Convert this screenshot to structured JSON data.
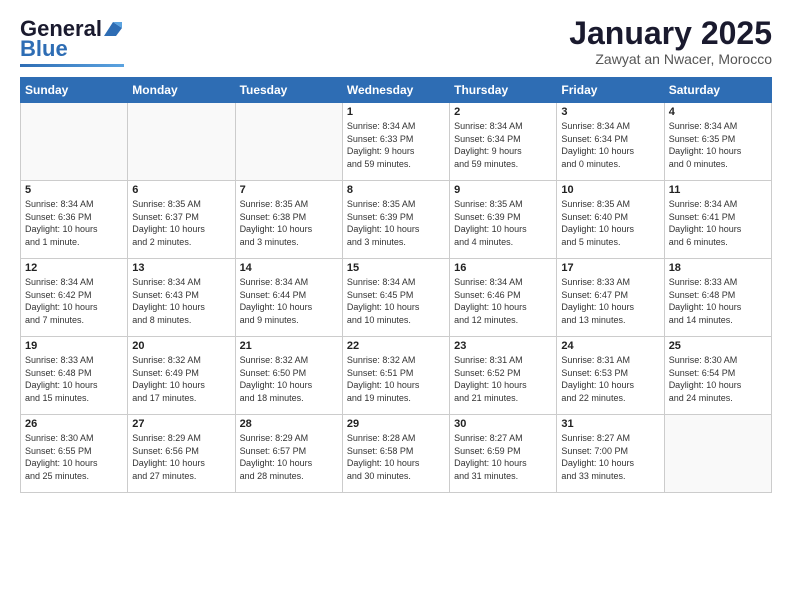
{
  "logo": {
    "line1": "General",
    "line2": "Blue"
  },
  "title": "January 2025",
  "subtitle": "Zawyat an Nwacer, Morocco",
  "days_of_week": [
    "Sunday",
    "Monday",
    "Tuesday",
    "Wednesday",
    "Thursday",
    "Friday",
    "Saturday"
  ],
  "weeks": [
    [
      {
        "num": "",
        "info": ""
      },
      {
        "num": "",
        "info": ""
      },
      {
        "num": "",
        "info": ""
      },
      {
        "num": "1",
        "info": "Sunrise: 8:34 AM\nSunset: 6:33 PM\nDaylight: 9 hours\nand 59 minutes."
      },
      {
        "num": "2",
        "info": "Sunrise: 8:34 AM\nSunset: 6:34 PM\nDaylight: 9 hours\nand 59 minutes."
      },
      {
        "num": "3",
        "info": "Sunrise: 8:34 AM\nSunset: 6:34 PM\nDaylight: 10 hours\nand 0 minutes."
      },
      {
        "num": "4",
        "info": "Sunrise: 8:34 AM\nSunset: 6:35 PM\nDaylight: 10 hours\nand 0 minutes."
      }
    ],
    [
      {
        "num": "5",
        "info": "Sunrise: 8:34 AM\nSunset: 6:36 PM\nDaylight: 10 hours\nand 1 minute."
      },
      {
        "num": "6",
        "info": "Sunrise: 8:35 AM\nSunset: 6:37 PM\nDaylight: 10 hours\nand 2 minutes."
      },
      {
        "num": "7",
        "info": "Sunrise: 8:35 AM\nSunset: 6:38 PM\nDaylight: 10 hours\nand 3 minutes."
      },
      {
        "num": "8",
        "info": "Sunrise: 8:35 AM\nSunset: 6:39 PM\nDaylight: 10 hours\nand 3 minutes."
      },
      {
        "num": "9",
        "info": "Sunrise: 8:35 AM\nSunset: 6:39 PM\nDaylight: 10 hours\nand 4 minutes."
      },
      {
        "num": "10",
        "info": "Sunrise: 8:35 AM\nSunset: 6:40 PM\nDaylight: 10 hours\nand 5 minutes."
      },
      {
        "num": "11",
        "info": "Sunrise: 8:34 AM\nSunset: 6:41 PM\nDaylight: 10 hours\nand 6 minutes."
      }
    ],
    [
      {
        "num": "12",
        "info": "Sunrise: 8:34 AM\nSunset: 6:42 PM\nDaylight: 10 hours\nand 7 minutes."
      },
      {
        "num": "13",
        "info": "Sunrise: 8:34 AM\nSunset: 6:43 PM\nDaylight: 10 hours\nand 8 minutes."
      },
      {
        "num": "14",
        "info": "Sunrise: 8:34 AM\nSunset: 6:44 PM\nDaylight: 10 hours\nand 9 minutes."
      },
      {
        "num": "15",
        "info": "Sunrise: 8:34 AM\nSunset: 6:45 PM\nDaylight: 10 hours\nand 10 minutes."
      },
      {
        "num": "16",
        "info": "Sunrise: 8:34 AM\nSunset: 6:46 PM\nDaylight: 10 hours\nand 12 minutes."
      },
      {
        "num": "17",
        "info": "Sunrise: 8:33 AM\nSunset: 6:47 PM\nDaylight: 10 hours\nand 13 minutes."
      },
      {
        "num": "18",
        "info": "Sunrise: 8:33 AM\nSunset: 6:48 PM\nDaylight: 10 hours\nand 14 minutes."
      }
    ],
    [
      {
        "num": "19",
        "info": "Sunrise: 8:33 AM\nSunset: 6:48 PM\nDaylight: 10 hours\nand 15 minutes."
      },
      {
        "num": "20",
        "info": "Sunrise: 8:32 AM\nSunset: 6:49 PM\nDaylight: 10 hours\nand 17 minutes."
      },
      {
        "num": "21",
        "info": "Sunrise: 8:32 AM\nSunset: 6:50 PM\nDaylight: 10 hours\nand 18 minutes."
      },
      {
        "num": "22",
        "info": "Sunrise: 8:32 AM\nSunset: 6:51 PM\nDaylight: 10 hours\nand 19 minutes."
      },
      {
        "num": "23",
        "info": "Sunrise: 8:31 AM\nSunset: 6:52 PM\nDaylight: 10 hours\nand 21 minutes."
      },
      {
        "num": "24",
        "info": "Sunrise: 8:31 AM\nSunset: 6:53 PM\nDaylight: 10 hours\nand 22 minutes."
      },
      {
        "num": "25",
        "info": "Sunrise: 8:30 AM\nSunset: 6:54 PM\nDaylight: 10 hours\nand 24 minutes."
      }
    ],
    [
      {
        "num": "26",
        "info": "Sunrise: 8:30 AM\nSunset: 6:55 PM\nDaylight: 10 hours\nand 25 minutes."
      },
      {
        "num": "27",
        "info": "Sunrise: 8:29 AM\nSunset: 6:56 PM\nDaylight: 10 hours\nand 27 minutes."
      },
      {
        "num": "28",
        "info": "Sunrise: 8:29 AM\nSunset: 6:57 PM\nDaylight: 10 hours\nand 28 minutes."
      },
      {
        "num": "29",
        "info": "Sunrise: 8:28 AM\nSunset: 6:58 PM\nDaylight: 10 hours\nand 30 minutes."
      },
      {
        "num": "30",
        "info": "Sunrise: 8:27 AM\nSunset: 6:59 PM\nDaylight: 10 hours\nand 31 minutes."
      },
      {
        "num": "31",
        "info": "Sunrise: 8:27 AM\nSunset: 7:00 PM\nDaylight: 10 hours\nand 33 minutes."
      },
      {
        "num": "",
        "info": ""
      }
    ]
  ]
}
